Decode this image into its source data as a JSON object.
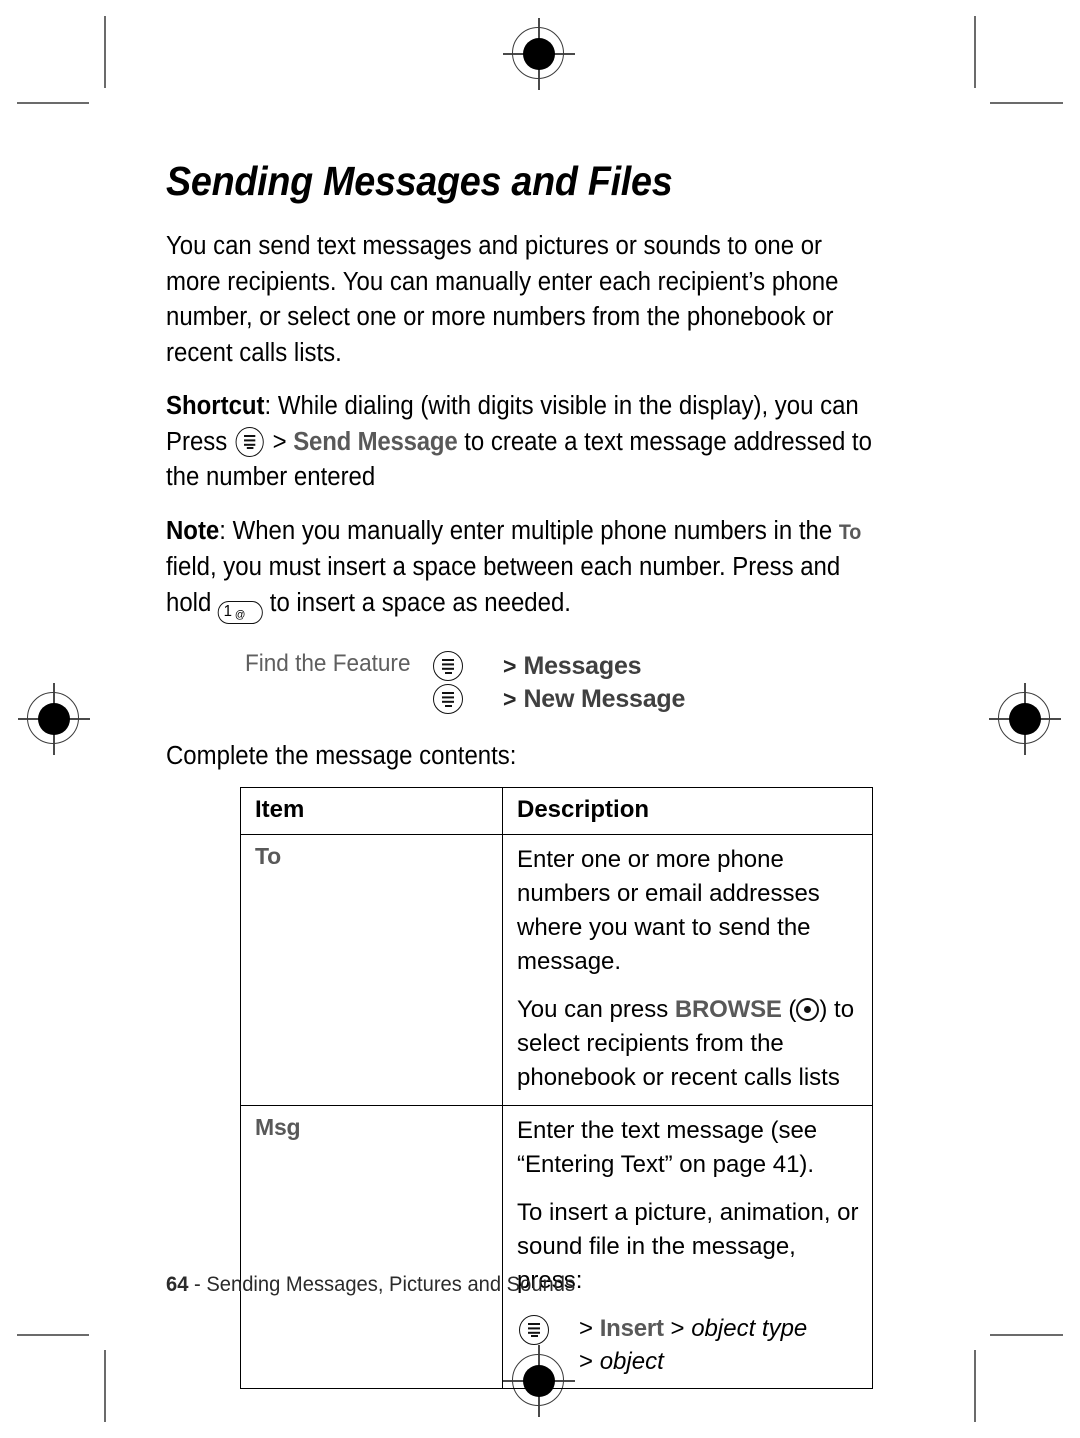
{
  "page": {
    "title": "Sending Messages and Files",
    "footer_page_number": "64",
    "footer_text": "- Sending Messages, Pictures and Sounds"
  },
  "intro": {
    "paragraph": "You can send text messages and pictures or sounds to one or more recipients. You can manually enter each recipient’s phone number, or select one or more numbers from the phonebook or recent calls lists."
  },
  "shortcut": {
    "label": "Shortcut",
    "text_before_key": ": While dialing (with digits visible in the display), you can Press",
    "menu_icon": "menu-key-icon",
    "separator": ">",
    "menu_item": "Send Message",
    "text_after": "to create a text message addressed to the number entered"
  },
  "note": {
    "label": "Note",
    "text_part1": ": When you manually enter multiple phone numbers in the",
    "field_name": "To",
    "text_part2": "field, you must insert a space between each number. Press and hold",
    "key_digit": "1",
    "key_symbol": "@",
    "text_part3": "to insert a space as needed."
  },
  "find_the_feature": {
    "label": "Find the Feature",
    "rows": [
      {
        "icon": "menu-key-icon",
        "arrow": ">",
        "name": "Messages"
      },
      {
        "icon": "menu-key-icon",
        "arrow": ">",
        "name": "New Message"
      }
    ]
  },
  "complete_line": "Complete the message contents:",
  "table": {
    "headers": [
      "Item",
      "Description"
    ],
    "rows": [
      {
        "item": "To",
        "paragraphs": [
          "Enter one or more phone numbers or email addresses where you want to send the message."
        ],
        "browse_line": {
          "text_before": "You can press",
          "soft_key": "BROWSE",
          "key_icon": "dot-key-icon",
          "text_after": "to select recipients from the phonebook or recent calls lists"
        }
      },
      {
        "item": "Msg",
        "paragraphs": [
          "Enter the text message (see “Entering Text” on page 41).",
          "To insert a picture, animation, or sound file in the message, press:"
        ],
        "insert_path": {
          "icon": "menu-key-icon",
          "line1_arrow": ">",
          "line1_menu": "Insert",
          "line1_arrow2": ">",
          "line1_italic": "object type",
          "line2_arrow": ">",
          "line2_italic": "object"
        }
      }
    ]
  },
  "print_marks": {
    "registration_mark_name": "registration-target",
    "crop_mark_name": "crop-mark"
  }
}
